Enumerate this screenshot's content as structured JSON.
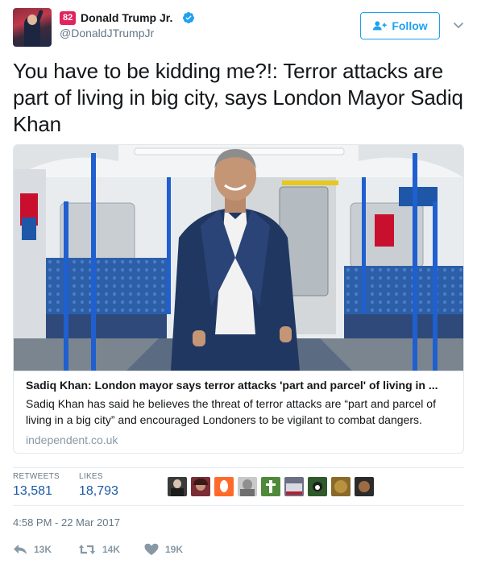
{
  "author": {
    "display_name": "Donald Trump Jr.",
    "handle": "@DonaldJTrumpJr",
    "notification_badge": "82",
    "verified": true,
    "avatar": "profile-photo"
  },
  "follow_button": {
    "label": "Follow",
    "icon": "add-user-icon"
  },
  "menu_icon": "chevron-down-icon",
  "tweet": {
    "text": "You have to be kidding me?!: Terror attacks are part of living in big city, says London Mayor Sadiq Khan"
  },
  "card": {
    "image": "man-in-suit-inside-subway-train-photo",
    "title": "Sadiq Khan: London mayor says terror attacks 'part and parcel' of living in ...",
    "description": "Sadiq Khan has said he believes the threat of terror attacks are “part and parcel of living in a big city” and encouraged Londoners to be vigilant to combat dangers.",
    "domain": "independent.co.uk"
  },
  "stats": {
    "retweets_label": "RETWEETS",
    "retweets_value": "13,581",
    "likes_label": "LIKES",
    "likes_value": "18,793",
    "liker_avatars": [
      "avatar-1",
      "avatar-2",
      "avatar-3",
      "avatar-4",
      "avatar-5",
      "avatar-6",
      "avatar-7",
      "avatar-8",
      "avatar-9"
    ]
  },
  "timestamp": "4:58 PM - 22 Mar 2017",
  "actions": {
    "reply": {
      "icon": "reply-icon",
      "count": "13K"
    },
    "retweet": {
      "icon": "retweet-icon",
      "count": "14K"
    },
    "like": {
      "icon": "heart-icon",
      "count": "19K"
    }
  },
  "colors": {
    "brand_blue": "#1da1f2",
    "link_blue": "#1b5aa8",
    "muted_gray": "#657786",
    "badge_red": "#e0245e"
  }
}
